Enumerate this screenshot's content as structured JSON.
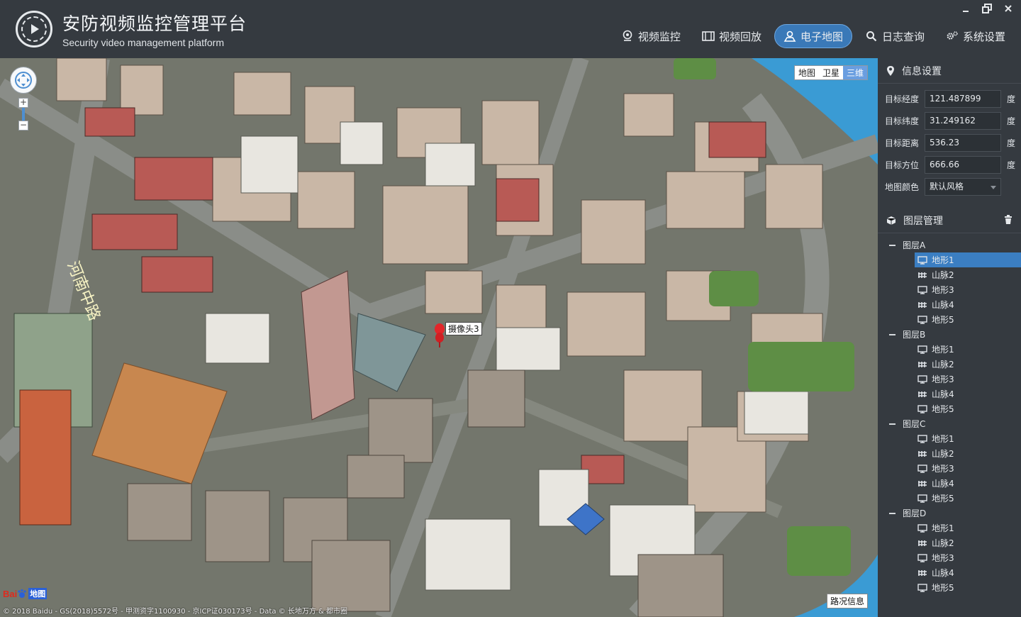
{
  "app": {
    "title_cn": "安防视频监控管理平台",
    "title_en": "Security video management platform"
  },
  "nav": [
    {
      "label": "视频监控",
      "icon": "camera-pin-icon",
      "active": false
    },
    {
      "label": "视频回放",
      "icon": "film-icon",
      "active": false
    },
    {
      "label": "电子地图",
      "icon": "map-user-icon",
      "active": true
    },
    {
      "label": "日志查询",
      "icon": "search-icon",
      "active": false
    },
    {
      "label": "系统设置",
      "icon": "gears-icon",
      "active": false
    }
  ],
  "map": {
    "types": [
      "地图",
      "卫星",
      "三维"
    ],
    "selected_type": "三维",
    "marker_label": "摄像头3",
    "baidu_text": "Bai",
    "baidu_badge": "地图",
    "copyright": "© 2018 Baidu - GS(2018)5572号 - 甲测资字1100930 - 京ICP证030173号 - Data © 长地万方 & 都市圈",
    "traffic_label": "路况信息",
    "road_label": "河南中路"
  },
  "info": {
    "title": "信息设置",
    "fields": [
      {
        "label": "目标经度",
        "value": "121.487899",
        "unit": "度"
      },
      {
        "label": "目标纬度",
        "value": "31.249162",
        "unit": "度"
      },
      {
        "label": "目标距离",
        "value": "536.23",
        "unit": "度"
      },
      {
        "label": "目标方位",
        "value": "666.66",
        "unit": "度"
      }
    ],
    "color_label": "地图颜色",
    "color_value": "默认风格"
  },
  "layers": {
    "title": "图层管理",
    "groups": [
      {
        "name": "图层A",
        "items": [
          {
            "label": "地形1",
            "type": "monitor",
            "selected": true
          },
          {
            "label": "山脉2",
            "type": "grid"
          },
          {
            "label": "地形3",
            "type": "monitor"
          },
          {
            "label": "山脉4",
            "type": "grid"
          },
          {
            "label": "地形5",
            "type": "monitor"
          }
        ]
      },
      {
        "name": "图层B",
        "items": [
          {
            "label": "地形1",
            "type": "monitor"
          },
          {
            "label": "山脉2",
            "type": "grid"
          },
          {
            "label": "地形3",
            "type": "monitor"
          },
          {
            "label": "山脉4",
            "type": "grid"
          },
          {
            "label": "地形5",
            "type": "monitor"
          }
        ]
      },
      {
        "name": "图层C",
        "items": [
          {
            "label": "地形1",
            "type": "monitor"
          },
          {
            "label": "山脉2",
            "type": "grid"
          },
          {
            "label": "地形3",
            "type": "monitor"
          },
          {
            "label": "山脉4",
            "type": "grid"
          },
          {
            "label": "地形5",
            "type": "monitor"
          }
        ]
      },
      {
        "name": "图层D",
        "items": [
          {
            "label": "地形1",
            "type": "monitor"
          },
          {
            "label": "山脉2",
            "type": "grid"
          },
          {
            "label": "地形3",
            "type": "monitor"
          },
          {
            "label": "山脉4",
            "type": "grid"
          },
          {
            "label": "地形5",
            "type": "monitor"
          }
        ]
      }
    ]
  },
  "colors": {
    "accent": "#3a79b8",
    "panel_bg": "#353a40",
    "river": "#3a9bd4"
  }
}
